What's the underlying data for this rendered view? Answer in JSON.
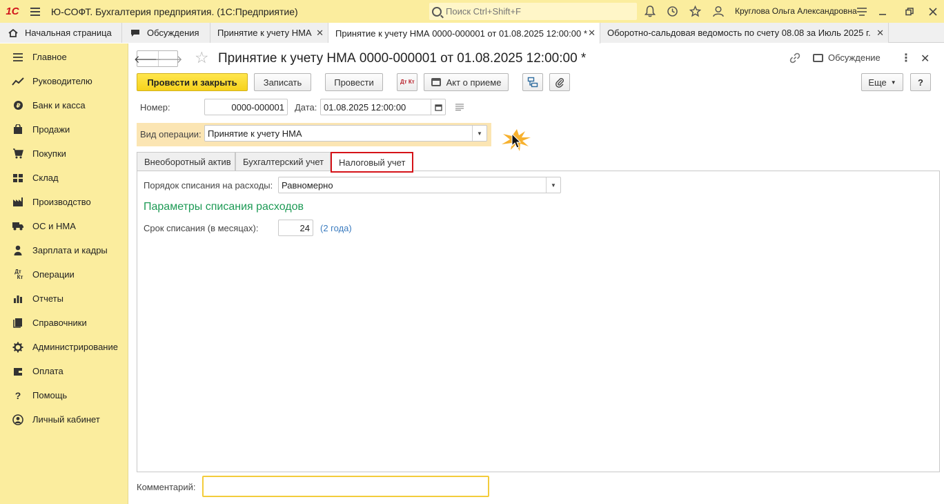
{
  "titlebar": {
    "logo": "1С",
    "app_title": "Ю-СОФТ. Бухгалтерия предприятия.  (1С:Предприятие)",
    "search_placeholder": "Поиск Ctrl+Shift+F",
    "user_name": "Круглова Ольга Александровна"
  },
  "tabs": [
    {
      "label": "Начальная страница"
    },
    {
      "label": "Обсуждения"
    },
    {
      "label": "Принятие к учету НМА"
    },
    {
      "label": "Принятие к учету НМА 0000-000001 от 01.08.2025 12:00:00 *"
    },
    {
      "label": "Оборотно-сальдовая ведомость по счету 08.08 за Июль 2025 г."
    }
  ],
  "sidebar": {
    "items": [
      {
        "label": "Главное",
        "icon": "menu-icon"
      },
      {
        "label": "Руководителю",
        "icon": "chart-line-icon"
      },
      {
        "label": "Банк и касса",
        "icon": "coin-icon"
      },
      {
        "label": "Продажи",
        "icon": "bag-icon"
      },
      {
        "label": "Покупки",
        "icon": "cart-icon"
      },
      {
        "label": "Склад",
        "icon": "warehouse-icon"
      },
      {
        "label": "Производство",
        "icon": "factory-icon"
      },
      {
        "label": "ОС и НМА",
        "icon": "truck-icon"
      },
      {
        "label": "Зарплата и кадры",
        "icon": "person-icon"
      },
      {
        "label": "Операции",
        "icon": "dt-kt-icon"
      },
      {
        "label": "Отчеты",
        "icon": "bar-chart-icon"
      },
      {
        "label": "Справочники",
        "icon": "book-icon"
      },
      {
        "label": "Администрирование",
        "icon": "gear-icon"
      },
      {
        "label": "Оплата",
        "icon": "wallet-icon"
      },
      {
        "label": "Помощь",
        "icon": "question-icon"
      },
      {
        "label": "Личный кабинет",
        "icon": "user-circle-icon"
      }
    ]
  },
  "document": {
    "title": "Принятие к учету НМА 0000-000001 от 01.08.2025 12:00:00 *",
    "discuss_label": "Обсуждение"
  },
  "toolbar": {
    "post_close": "Провести и закрыть",
    "save": "Записать",
    "post": "Провести",
    "dt_kt": "Дт Кт",
    "act": "Акт о приеме",
    "more": "Еще",
    "help": "?"
  },
  "form": {
    "number_label": "Номер:",
    "number_value": "0000-000001",
    "date_label": "Дата:",
    "date_value": "01.08.2025 12:00:00",
    "operation_label": "Вид операции:",
    "operation_value": "Принятие к учету НМА"
  },
  "form_tabs": [
    {
      "label": "Внеоборотный актив"
    },
    {
      "label": "Бухгалтерский учет"
    },
    {
      "label": "Налоговый учет"
    }
  ],
  "tax_tab": {
    "writeoff_order_label": "Порядок списания на расходы:",
    "writeoff_order_value": "Равномерно",
    "section_title": "Параметры списания расходов",
    "term_label": "Срок списания (в месяцах):",
    "term_value": "24",
    "term_hint": "(2 года)"
  },
  "comment": {
    "label": "Комментарий:",
    "value": ""
  }
}
